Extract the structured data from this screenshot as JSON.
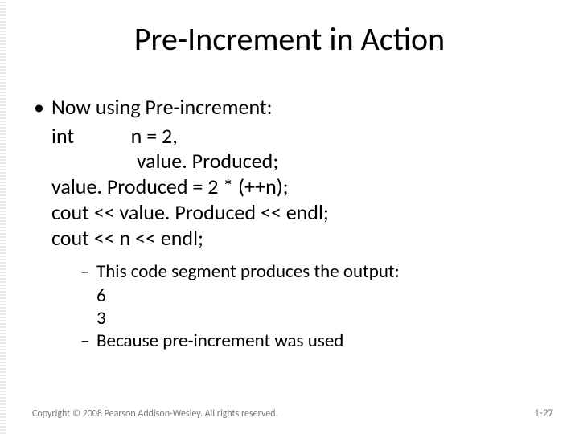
{
  "title": "Pre-Increment in Action",
  "bullet_main": "Now using Pre-increment:",
  "code": {
    "l1a": "int",
    "l1b": "n = 2,",
    "l2": "value. Produced;",
    "l3": "value. Produced = 2 * (++n);",
    "l4": "cout << value. Produced << endl;",
    "l5": "cout << n << endl;"
  },
  "sub": {
    "s1": "This code segment produces the output:",
    "out1": "6",
    "out2": "3",
    "s2": "Because pre-increment was used"
  },
  "footer": {
    "copyright": "Copyright © 2008 Pearson Addison-Wesley. All rights reserved.",
    "page": "1-27"
  }
}
